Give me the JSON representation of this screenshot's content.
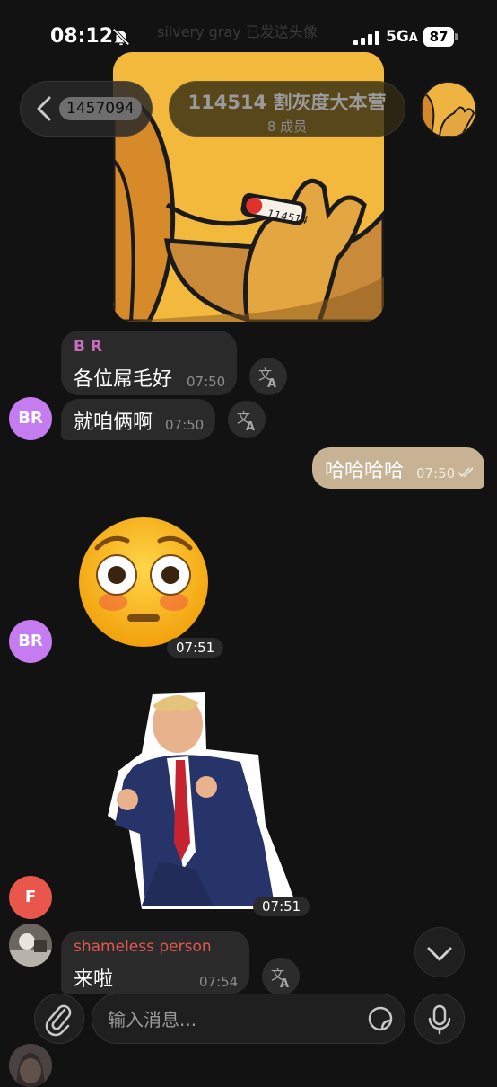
{
  "status_bar": {
    "time": "08:12",
    "network": "5G",
    "network_suffix": "A",
    "battery": "87"
  },
  "faded_top": {
    "text": "silvery gray 已发送头像"
  },
  "header": {
    "back_count": "1457094",
    "title": "114514 割灰度大本营",
    "subtitle": "8 成员"
  },
  "sticker": {
    "caption": "114514"
  },
  "messages": {
    "m1": {
      "sender": "B R",
      "text": "各位屌毛好",
      "time": "07:50"
    },
    "m2": {
      "text": "就咱俩啊",
      "time": "07:50"
    },
    "m3": {
      "text": "哈哈哈哈",
      "time": "07:50"
    },
    "m4": {
      "time": "07:51"
    },
    "m5": {
      "time": "07:51"
    },
    "m6": {
      "sender": "shameless person",
      "text": "来啦",
      "time": "07:54"
    }
  },
  "avatars": {
    "br": "BR",
    "f": "F"
  },
  "composer": {
    "placeholder": "输入消息..."
  },
  "colors": {
    "background": "#121212",
    "bubble": "#2a2a2a",
    "my_bubble": "#c7b293",
    "sender_br": "#c66fbe",
    "sender_shameless": "#e2584f",
    "avatar_br": "#c57cf0",
    "avatar_f": "#e8564c"
  }
}
